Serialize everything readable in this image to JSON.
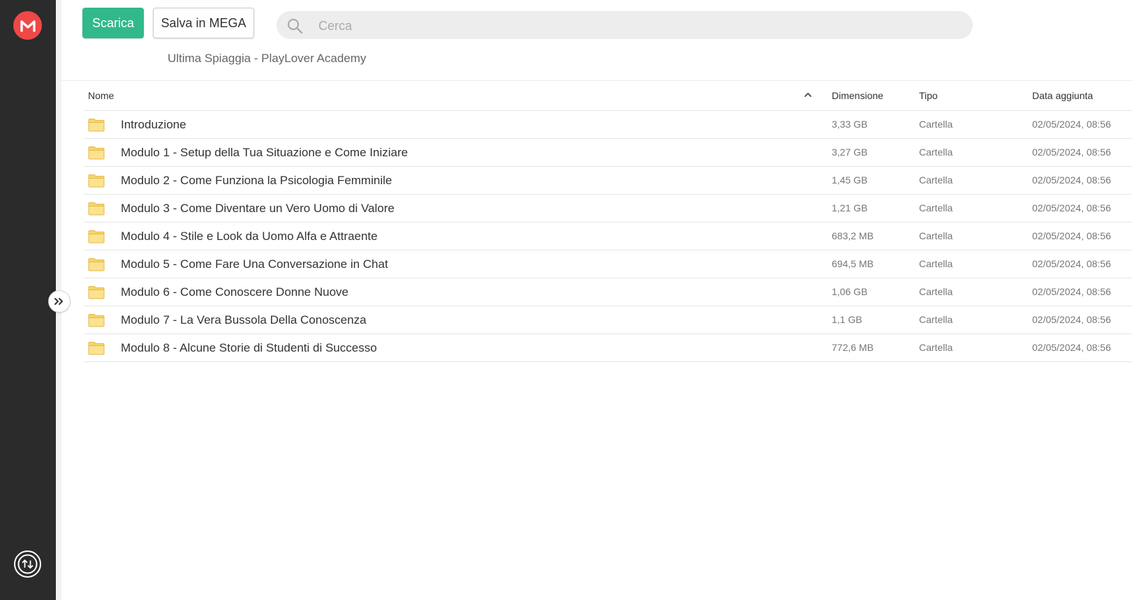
{
  "toolbar": {
    "download_label": "Scarica",
    "save_label": "Salva in MEGA"
  },
  "search": {
    "placeholder": "Cerca"
  },
  "folder_title": "Ultima Spiaggia - PlayLover Academy",
  "table": {
    "headers": {
      "name": "Nome",
      "size": "Dimensione",
      "type": "Tipo",
      "date": "Data aggiunta"
    },
    "rows": [
      {
        "name": "Introduzione",
        "size": "3,33 GB",
        "type": "Cartella",
        "date": "02/05/2024, 08:56"
      },
      {
        "name": "Modulo 1 - Setup della Tua Situazione e Come Iniziare",
        "size": "3,27 GB",
        "type": "Cartella",
        "date": "02/05/2024, 08:56"
      },
      {
        "name": "Modulo 2 - Come Funziona la Psicologia Femminile",
        "size": "1,45 GB",
        "type": "Cartella",
        "date": "02/05/2024, 08:56"
      },
      {
        "name": "Modulo 3 - Come Diventare un Vero Uomo di Valore",
        "size": "1,21 GB",
        "type": "Cartella",
        "date": "02/05/2024, 08:56"
      },
      {
        "name": "Modulo 4 - Stile e Look da Uomo Alfa e Attraente",
        "size": "683,2 MB",
        "type": "Cartella",
        "date": "02/05/2024, 08:56"
      },
      {
        "name": "Modulo 5 - Come Fare Una Conversazione in Chat",
        "size": "694,5 MB",
        "type": "Cartella",
        "date": "02/05/2024, 08:56"
      },
      {
        "name": "Modulo 6 - Come Conoscere Donne Nuove",
        "size": "1,06 GB",
        "type": "Cartella",
        "date": "02/05/2024, 08:56"
      },
      {
        "name": "Modulo 7 - La Vera Bussola Della Conoscenza",
        "size": "1,1 GB",
        "type": "Cartella",
        "date": "02/05/2024, 08:56"
      },
      {
        "name": "Modulo 8 - Alcune Storie di Studenti di Successo",
        "size": "772,6 MB",
        "type": "Cartella",
        "date": "02/05/2024, 08:56"
      }
    ]
  },
  "icons": {
    "logo": "mega-logo-icon",
    "sync": "transfer-sync-icon",
    "expand": "double-chevron-right-icon",
    "search": "search-icon",
    "sort": "chevron-up-icon",
    "folder": "folder-icon"
  },
  "colors": {
    "sidebar": "#2b2b2b",
    "brand_red": "#f04747",
    "download_green": "#31b98b",
    "folder_yellow": "#f7d56b"
  }
}
